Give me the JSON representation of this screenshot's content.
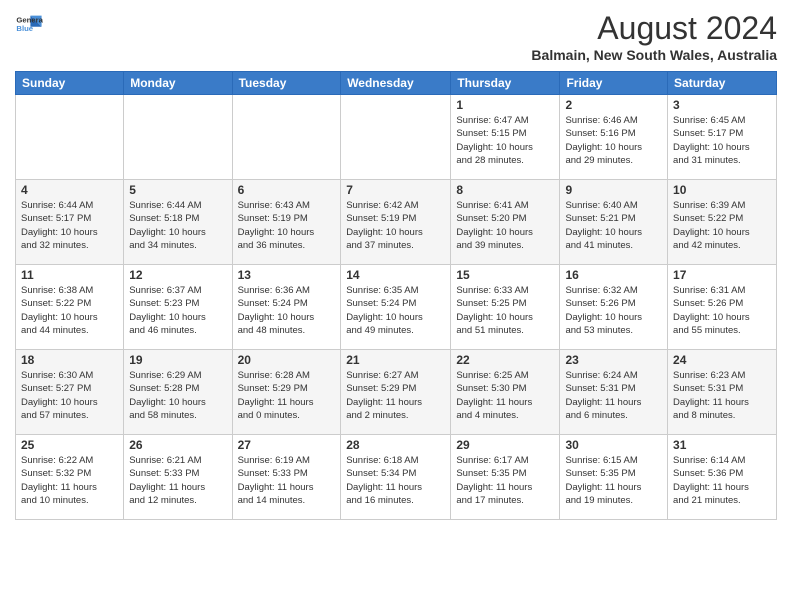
{
  "header": {
    "logo": {
      "line1": "General",
      "line2": "Blue"
    },
    "title": "August 2024",
    "subtitle": "Balmain, New South Wales, Australia"
  },
  "calendar": {
    "days_of_week": [
      "Sunday",
      "Monday",
      "Tuesday",
      "Wednesday",
      "Thursday",
      "Friday",
      "Saturday"
    ],
    "weeks": [
      [
        {
          "day": "",
          "info": ""
        },
        {
          "day": "",
          "info": ""
        },
        {
          "day": "",
          "info": ""
        },
        {
          "day": "",
          "info": ""
        },
        {
          "day": "1",
          "info": "Sunrise: 6:47 AM\nSunset: 5:15 PM\nDaylight: 10 hours\nand 28 minutes."
        },
        {
          "day": "2",
          "info": "Sunrise: 6:46 AM\nSunset: 5:16 PM\nDaylight: 10 hours\nand 29 minutes."
        },
        {
          "day": "3",
          "info": "Sunrise: 6:45 AM\nSunset: 5:17 PM\nDaylight: 10 hours\nand 31 minutes."
        }
      ],
      [
        {
          "day": "4",
          "info": "Sunrise: 6:44 AM\nSunset: 5:17 PM\nDaylight: 10 hours\nand 32 minutes."
        },
        {
          "day": "5",
          "info": "Sunrise: 6:44 AM\nSunset: 5:18 PM\nDaylight: 10 hours\nand 34 minutes."
        },
        {
          "day": "6",
          "info": "Sunrise: 6:43 AM\nSunset: 5:19 PM\nDaylight: 10 hours\nand 36 minutes."
        },
        {
          "day": "7",
          "info": "Sunrise: 6:42 AM\nSunset: 5:19 PM\nDaylight: 10 hours\nand 37 minutes."
        },
        {
          "day": "8",
          "info": "Sunrise: 6:41 AM\nSunset: 5:20 PM\nDaylight: 10 hours\nand 39 minutes."
        },
        {
          "day": "9",
          "info": "Sunrise: 6:40 AM\nSunset: 5:21 PM\nDaylight: 10 hours\nand 41 minutes."
        },
        {
          "day": "10",
          "info": "Sunrise: 6:39 AM\nSunset: 5:22 PM\nDaylight: 10 hours\nand 42 minutes."
        }
      ],
      [
        {
          "day": "11",
          "info": "Sunrise: 6:38 AM\nSunset: 5:22 PM\nDaylight: 10 hours\nand 44 minutes."
        },
        {
          "day": "12",
          "info": "Sunrise: 6:37 AM\nSunset: 5:23 PM\nDaylight: 10 hours\nand 46 minutes."
        },
        {
          "day": "13",
          "info": "Sunrise: 6:36 AM\nSunset: 5:24 PM\nDaylight: 10 hours\nand 48 minutes."
        },
        {
          "day": "14",
          "info": "Sunrise: 6:35 AM\nSunset: 5:24 PM\nDaylight: 10 hours\nand 49 minutes."
        },
        {
          "day": "15",
          "info": "Sunrise: 6:33 AM\nSunset: 5:25 PM\nDaylight: 10 hours\nand 51 minutes."
        },
        {
          "day": "16",
          "info": "Sunrise: 6:32 AM\nSunset: 5:26 PM\nDaylight: 10 hours\nand 53 minutes."
        },
        {
          "day": "17",
          "info": "Sunrise: 6:31 AM\nSunset: 5:26 PM\nDaylight: 10 hours\nand 55 minutes."
        }
      ],
      [
        {
          "day": "18",
          "info": "Sunrise: 6:30 AM\nSunset: 5:27 PM\nDaylight: 10 hours\nand 57 minutes."
        },
        {
          "day": "19",
          "info": "Sunrise: 6:29 AM\nSunset: 5:28 PM\nDaylight: 10 hours\nand 58 minutes."
        },
        {
          "day": "20",
          "info": "Sunrise: 6:28 AM\nSunset: 5:29 PM\nDaylight: 11 hours\nand 0 minutes."
        },
        {
          "day": "21",
          "info": "Sunrise: 6:27 AM\nSunset: 5:29 PM\nDaylight: 11 hours\nand 2 minutes."
        },
        {
          "day": "22",
          "info": "Sunrise: 6:25 AM\nSunset: 5:30 PM\nDaylight: 11 hours\nand 4 minutes."
        },
        {
          "day": "23",
          "info": "Sunrise: 6:24 AM\nSunset: 5:31 PM\nDaylight: 11 hours\nand 6 minutes."
        },
        {
          "day": "24",
          "info": "Sunrise: 6:23 AM\nSunset: 5:31 PM\nDaylight: 11 hours\nand 8 minutes."
        }
      ],
      [
        {
          "day": "25",
          "info": "Sunrise: 6:22 AM\nSunset: 5:32 PM\nDaylight: 11 hours\nand 10 minutes."
        },
        {
          "day": "26",
          "info": "Sunrise: 6:21 AM\nSunset: 5:33 PM\nDaylight: 11 hours\nand 12 minutes."
        },
        {
          "day": "27",
          "info": "Sunrise: 6:19 AM\nSunset: 5:33 PM\nDaylight: 11 hours\nand 14 minutes."
        },
        {
          "day": "28",
          "info": "Sunrise: 6:18 AM\nSunset: 5:34 PM\nDaylight: 11 hours\nand 16 minutes."
        },
        {
          "day": "29",
          "info": "Sunrise: 6:17 AM\nSunset: 5:35 PM\nDaylight: 11 hours\nand 17 minutes."
        },
        {
          "day": "30",
          "info": "Sunrise: 6:15 AM\nSunset: 5:35 PM\nDaylight: 11 hours\nand 19 minutes."
        },
        {
          "day": "31",
          "info": "Sunrise: 6:14 AM\nSunset: 5:36 PM\nDaylight: 11 hours\nand 21 minutes."
        }
      ]
    ]
  }
}
